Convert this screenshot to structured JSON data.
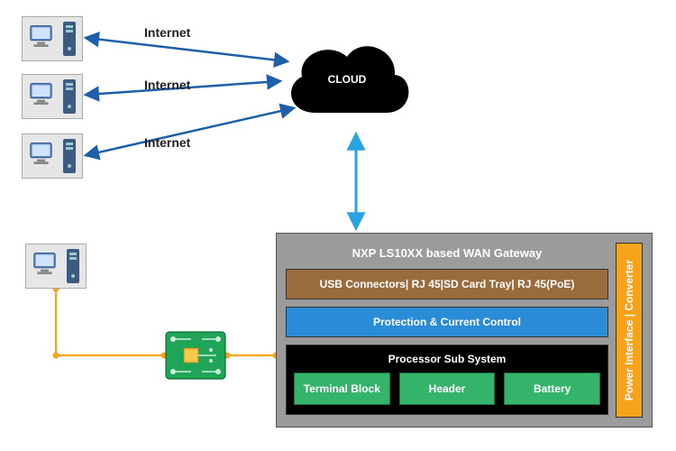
{
  "computers": [
    {
      "label": "Internet"
    },
    {
      "label": "Internet"
    },
    {
      "label": "Internet"
    }
  ],
  "cloud": {
    "label": "CLOUD"
  },
  "gateway": {
    "title": "NXP LS10XX based WAN Gateway",
    "usb_row": "USB Connectors| RJ 45|SD Card Tray| RJ 45(PoE)",
    "protection_row": "Protection & Current Control",
    "processor_title": "Processor Sub System",
    "processor_cells": [
      "Terminal Block",
      "Header",
      "Battery"
    ],
    "side": "Power Interface | Converter"
  },
  "colors": {
    "arrow_blue": "#1d5fa8",
    "arrow_light_blue": "#2aa4e0",
    "wire_orange": "#f8a21c"
  }
}
